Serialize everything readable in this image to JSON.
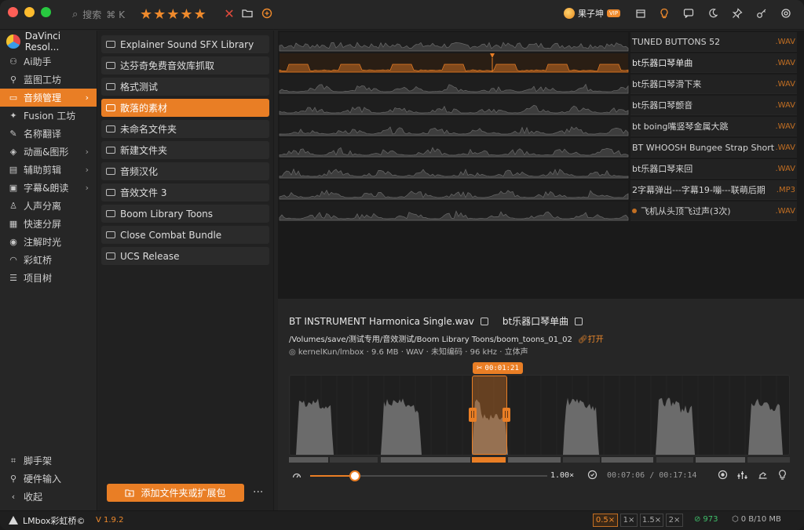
{
  "titlebar": {
    "search_label": "搜索",
    "search_shortcut": "⌘ K",
    "rating": 5,
    "username": "果子坤",
    "vip_badge": "VIP"
  },
  "sidebar": {
    "app_name": "DaVinci Resol...",
    "items": [
      {
        "label": "Ai助手",
        "icon": "robot-icon"
      },
      {
        "label": "蓝图工坊",
        "icon": "blueprint-icon"
      },
      {
        "label": "音频管理",
        "icon": "audio-folder-icon",
        "active": true,
        "chevron": true
      },
      {
        "label": "Fusion 工坊",
        "icon": "fusion-icon"
      },
      {
        "label": "名称翻译",
        "icon": "translate-icon"
      },
      {
        "label": "动画&图形",
        "icon": "animation-icon",
        "chevron": true
      },
      {
        "label": "辅助剪辑",
        "icon": "edit-icon",
        "chevron": true
      },
      {
        "label": "字幕&朗读",
        "icon": "subtitle-icon",
        "chevron": true
      },
      {
        "label": "人声分离",
        "icon": "voice-icon"
      },
      {
        "label": "快速分屏",
        "icon": "split-icon"
      },
      {
        "label": "注解时光",
        "icon": "annotation-icon"
      },
      {
        "label": "彩虹桥",
        "icon": "rainbow-icon"
      },
      {
        "label": "项目树",
        "icon": "tree-icon"
      }
    ],
    "bottom_items": [
      {
        "label": "脚手架",
        "icon": "scaffold-icon"
      },
      {
        "label": "硬件输入",
        "icon": "joystick-icon"
      },
      {
        "label": "收起",
        "icon": "collapse-icon"
      }
    ]
  },
  "folders": {
    "items": [
      "Explainer Sound SFX Library",
      "达芬奇免费音效库抓取",
      "格式测试",
      "散落的素材",
      "未命名文件夹",
      "新建文件夹",
      "音频汉化",
      "音效文件 3",
      "Boom Library Toons",
      "Close Combat Bundle",
      "UCS Release"
    ],
    "active_index": 3,
    "add_button": "添加文件夹或扩展包",
    "more": "···"
  },
  "tracks": [
    {
      "name": "TUNED BUTTONS 52",
      "ext": ".WAV"
    },
    {
      "name": "bt乐器口琴单曲",
      "ext": ".WAV",
      "active": true
    },
    {
      "name": "bt乐器口琴滑下来",
      "ext": ".WAV"
    },
    {
      "name": "bt乐器口琴颤音",
      "ext": ".WAV"
    },
    {
      "name": "bt boing嘴竖琴金属大跳",
      "ext": ".WAV"
    },
    {
      "name": "BT WHOOSH Bungee Strap Short",
      "ext": ".WAV"
    },
    {
      "name": "bt乐器口琴来回",
      "ext": ".WAV"
    },
    {
      "name": "2字幕弹出---字幕19-嘣---联萌后期",
      "ext": ".MP3"
    },
    {
      "name": "飞机从头顶飞过声(3次)",
      "ext": ".WAV",
      "dot": true
    }
  ],
  "detail": {
    "filename": "BT INSTRUMENT Harmonica Single.wav",
    "alias": "bt乐器口琴单曲",
    "path": "/Volumes/save/测试专用/音效测试/Boom Library Toons/boom_toons_01_02",
    "open_label": "打开",
    "author": "kernelKun/lmbox",
    "size": "9.6 MB",
    "format": "WAV",
    "encoding": "未知编码",
    "rate": "96 kHz",
    "channels": "立体声",
    "marker_time": "00:01:21",
    "speed": "1.00×",
    "speed_fraction": 0.19,
    "current_time": "00:07:06",
    "total_time": "00:17:14"
  },
  "statusbar": {
    "brand": "LMbox彩虹桥©",
    "version": "V 1.9.2",
    "zoom_options": [
      "0.5×",
      "1×",
      "1.5×",
      "2×"
    ],
    "zoom_active": 0,
    "count": "973",
    "storage": "0 B/10 MB"
  },
  "colors": {
    "accent": "#e97e25",
    "background": "#232323",
    "panel": "#262626"
  }
}
